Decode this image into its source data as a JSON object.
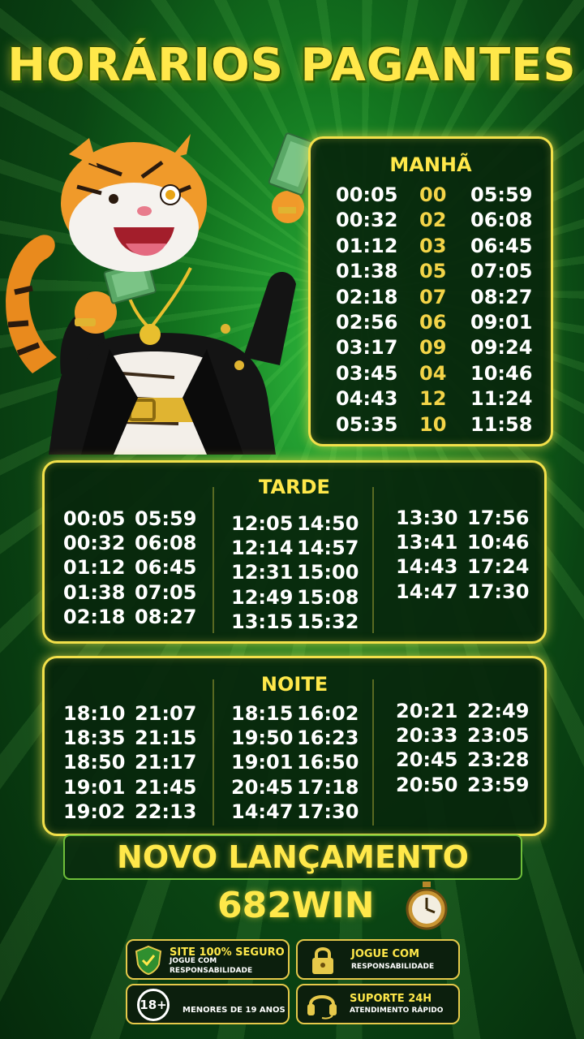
{
  "title": "HORÁRIOS PAGANTES",
  "morning": {
    "label": "MANHÃ",
    "rows": [
      [
        "00:05",
        "00",
        "05:59"
      ],
      [
        "00:32",
        "02",
        "06:08"
      ],
      [
        "01:12",
        "03",
        "06:45"
      ],
      [
        "01:38",
        "05",
        "07:05"
      ],
      [
        "02:18",
        "07",
        "08:27"
      ],
      [
        "02:56",
        "06",
        "09:01"
      ],
      [
        "03:17",
        "09",
        "09:24"
      ],
      [
        "03:45",
        "04",
        "10:46"
      ],
      [
        "04:43",
        "12",
        "11:24"
      ],
      [
        "05:35",
        "10",
        "11:58"
      ]
    ]
  },
  "afternoon": {
    "label": "TARDE",
    "col1": [
      [
        "00:05",
        "05:59"
      ],
      [
        "00:32",
        "06:08"
      ],
      [
        "01:12",
        "06:45"
      ],
      [
        "01:38",
        "07:05"
      ],
      [
        "02:18",
        "08:27"
      ]
    ],
    "col2": [
      [
        "12:05",
        "14:50"
      ],
      [
        "12:14",
        "14:57"
      ],
      [
        "12:31",
        "15:00"
      ],
      [
        "12:49",
        "15:08"
      ],
      [
        "13:15",
        "15:32"
      ]
    ],
    "col3": [
      [
        "13:30",
        "17:56"
      ],
      [
        "13:41",
        "10:46"
      ],
      [
        "14:43",
        "17:24"
      ],
      [
        "14:47",
        "17:30"
      ]
    ]
  },
  "night": {
    "label": "NOITE",
    "col1": [
      [
        "18:10",
        "21:07"
      ],
      [
        "18:35",
        "21:15"
      ],
      [
        "18:50",
        "21:17"
      ],
      [
        "19:01",
        "21:45"
      ],
      [
        "19:02",
        "22:13"
      ]
    ],
    "col2": [
      [
        "18:15",
        "16:02"
      ],
      [
        "19:50",
        "16:23"
      ],
      [
        "19:01",
        "16:50"
      ],
      [
        "20:45",
        "17:18"
      ],
      [
        "14:47",
        "17:30"
      ]
    ],
    "col3": [
      [
        "20:21",
        "22:49"
      ],
      [
        "20:33",
        "23:05"
      ],
      [
        "20:45",
        "23:28"
      ],
      [
        "20:50",
        "23:59"
      ]
    ]
  },
  "banner": "NOVO LANÇAMENTO",
  "brand": "682WIN",
  "badges": {
    "secure": {
      "title": "SITE 100% SEGURO",
      "line1": "JOGUE COM",
      "line2": "RESPONSABILIDADE"
    },
    "play": {
      "title": "JOGUE COM",
      "sub": "RESPONSABILIDADE"
    },
    "age": {
      "icon_text": "18+",
      "text": "MENORES DE 19 ANOS"
    },
    "support": {
      "title": "SUPORTE 24H",
      "sub": "ATENDIMENTO RÁPIDO"
    }
  },
  "colors": {
    "accent": "#ffe84a",
    "border": "#f2e04a",
    "bg": "#0a4413"
  }
}
